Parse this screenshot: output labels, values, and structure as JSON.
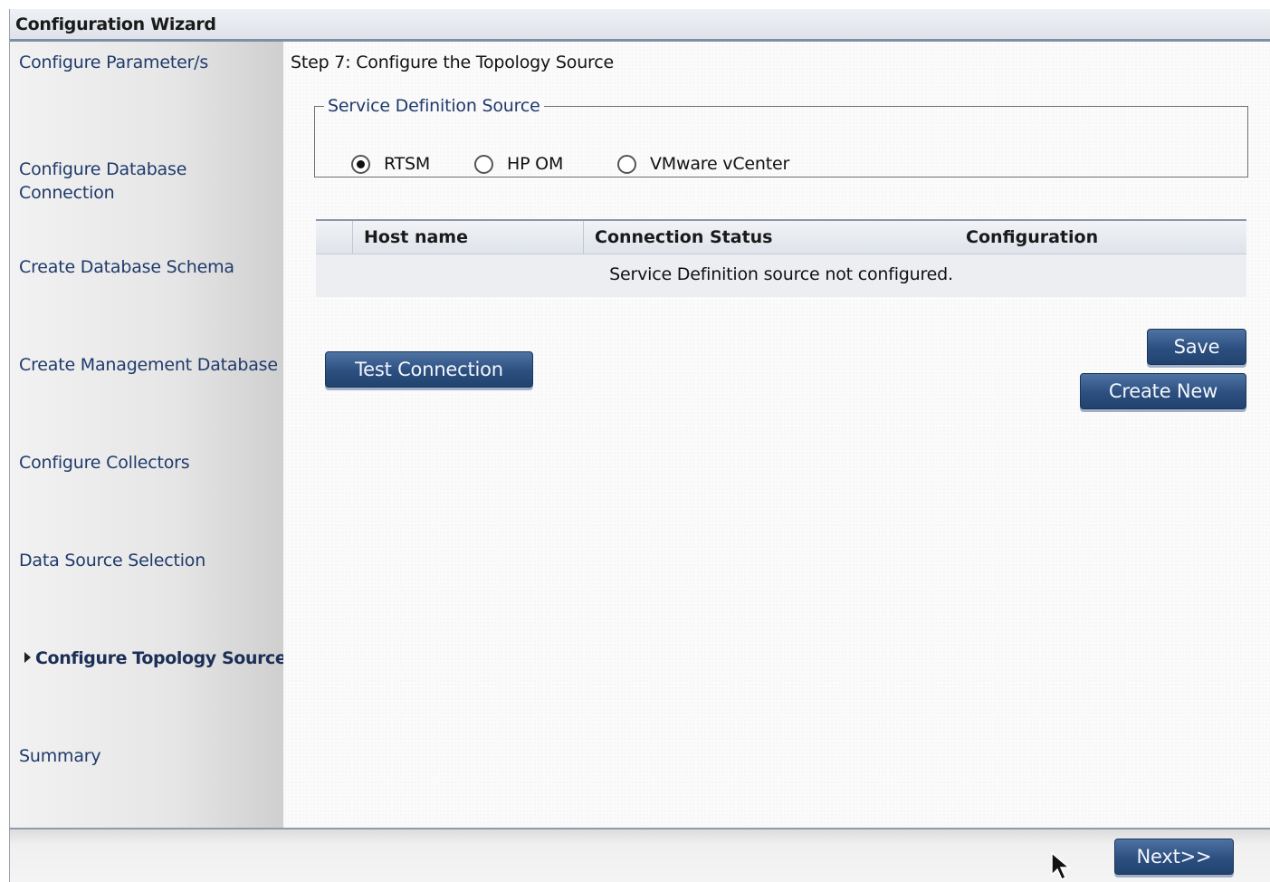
{
  "window": {
    "title": "Configuration Wizard"
  },
  "sidebar": {
    "steps": [
      {
        "label": "Configure Parameter/s",
        "current": false
      },
      {
        "label": "Configure Database Connection",
        "current": false
      },
      {
        "label": "Create Database Schema",
        "current": false
      },
      {
        "label": "Create Management Database",
        "current": false
      },
      {
        "label": "Configure Collectors",
        "current": false
      },
      {
        "label": "Data Source Selection",
        "current": false
      },
      {
        "label": "Configure Topology Source",
        "current": true
      },
      {
        "label": "Summary",
        "current": false
      }
    ]
  },
  "main": {
    "step_title": "Step 7: Configure the Topology Source",
    "service_definition": {
      "legend": "Service Definition Source",
      "options": [
        {
          "label": "RTSM",
          "selected": true
        },
        {
          "label": "HP OM",
          "selected": false
        },
        {
          "label": "VMware vCenter",
          "selected": false
        }
      ]
    },
    "table": {
      "columns": [
        "Host name",
        "Connection Status",
        "Configuration"
      ],
      "empty_message": "Service Definition source not configured."
    },
    "buttons": {
      "test_connection": "Test Connection",
      "save": "Save",
      "create_new": "Create New"
    }
  },
  "footer": {
    "next_label": "Next>>"
  },
  "colors": {
    "button_gradient_top": "#4e73a3",
    "button_gradient_bottom": "#22436f",
    "sidebar_text": "#1f3a6b",
    "header_border": "#7e8ea6"
  }
}
